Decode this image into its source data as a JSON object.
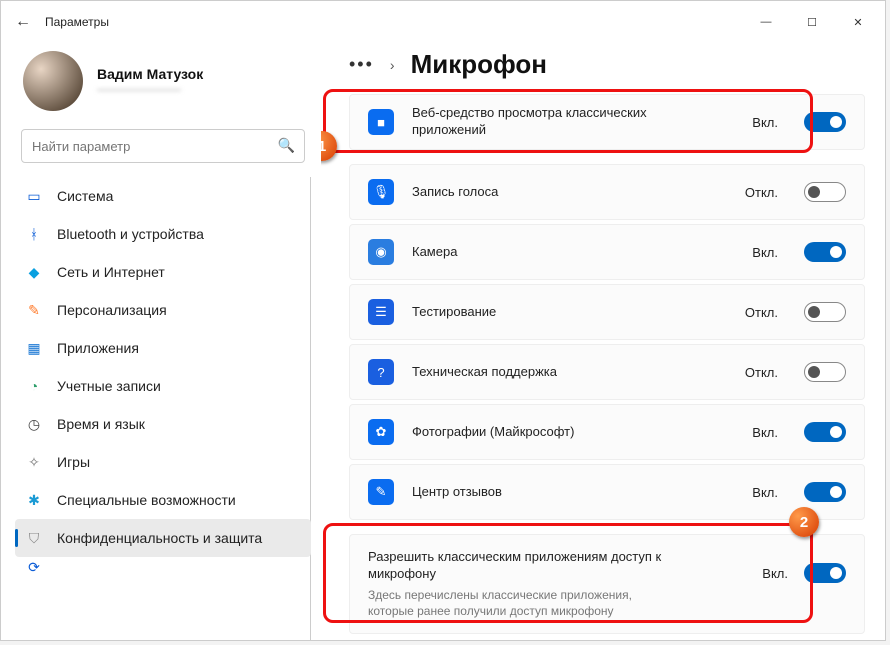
{
  "window": {
    "title": "Параметры"
  },
  "profile": {
    "name": "Вадим Матузок",
    "email": "———————"
  },
  "search": {
    "placeholder": "Найти параметр"
  },
  "nav": [
    {
      "id": "system",
      "label": "Система",
      "color": "#0b5cd6",
      "glyph": "▭"
    },
    {
      "id": "bluetooth",
      "label": "Bluetooth и устройства",
      "color": "#0b5cd6",
      "glyph": "ᚼ"
    },
    {
      "id": "network",
      "label": "Сеть и Интернет",
      "color": "#0aa0e0",
      "glyph": "◆"
    },
    {
      "id": "personalization",
      "label": "Персонализация",
      "color": "#ff7a2a",
      "glyph": "✎"
    },
    {
      "id": "apps",
      "label": "Приложения",
      "color": "#1a77d4",
      "glyph": "▦"
    },
    {
      "id": "accounts",
      "label": "Учетные записи",
      "color": "#2e9e6b",
      "glyph": "◔"
    },
    {
      "id": "time",
      "label": "Время и язык",
      "color": "#444",
      "glyph": "◷"
    },
    {
      "id": "gaming",
      "label": "Игры",
      "color": "#777",
      "glyph": "✧"
    },
    {
      "id": "accessibility",
      "label": "Специальные возможности",
      "color": "#1a9ad4",
      "glyph": "✱"
    },
    {
      "id": "privacy",
      "label": "Конфиденциальность и защита",
      "color": "#888",
      "glyph": "⛉",
      "active": true
    }
  ],
  "page": {
    "title": "Микрофон"
  },
  "state_labels": {
    "on": "Вкл.",
    "off": "Откл."
  },
  "apps": [
    {
      "id": "webviewer",
      "label": "Веб-средство просмотра классических приложений",
      "on": true,
      "iconColor": "#0a6cf0",
      "glyph": "■"
    },
    {
      "id": "voicerec",
      "label": "Запись голоса",
      "on": false,
      "iconColor": "#0a6cf0",
      "glyph": "🎙"
    },
    {
      "id": "camera",
      "label": "Камера",
      "on": true,
      "iconColor": "#2a7de0",
      "glyph": "◉"
    },
    {
      "id": "testing",
      "label": "Тестирование",
      "on": false,
      "iconColor": "#1a5fe0",
      "glyph": "☰"
    },
    {
      "id": "support",
      "label": "Техническая поддержка",
      "on": false,
      "iconColor": "#1a5fe0",
      "glyph": "?"
    },
    {
      "id": "photos",
      "label": "Фотографии (Майкрософт)",
      "on": true,
      "iconColor": "#0a6cf0",
      "glyph": "✿"
    },
    {
      "id": "feedback",
      "label": "Центр отзывов",
      "on": true,
      "iconColor": "#0a6cf0",
      "glyph": "✎"
    }
  ],
  "desktop_section": {
    "title": "Разрешить классическим приложениям доступ к микрофону",
    "sub": "Здесь перечислены классические приложения, которые ранее получили доступ микрофону",
    "on": true
  },
  "annotations": {
    "marker1": "1",
    "marker2": "2"
  }
}
